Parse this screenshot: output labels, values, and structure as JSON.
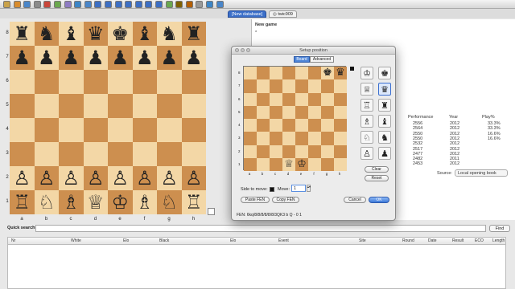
{
  "toolbar": {
    "icons": [
      "new-icon",
      "open-icon",
      "save-icon",
      "print-icon",
      "user-icon",
      "flag-icon",
      "engine-icon",
      "board-icon",
      "refresh-icon",
      "first-icon",
      "back-icon",
      "play-icon",
      "forward-icon",
      "last-icon",
      "next-icon",
      "stop-icon",
      "add-icon",
      "player-icon",
      "book-icon",
      "pin-icon",
      "comment-icon",
      "edit-icon"
    ]
  },
  "tabs": [
    {
      "label": "[New database]",
      "selected": true
    },
    {
      "label": "twic909",
      "selected": false
    }
  ],
  "board": {
    "ranks": [
      "8",
      "7",
      "6",
      "5",
      "4",
      "3",
      "2",
      "1"
    ],
    "files": [
      "a",
      "b",
      "c",
      "d",
      "e",
      "f",
      "g",
      "h"
    ],
    "position": [
      [
        "♜",
        "♞",
        "♝",
        "♛",
        "♚",
        "♝",
        "♞",
        "♜"
      ],
      [
        "♟",
        "♟",
        "♟",
        "♟",
        "♟",
        "♟",
        "♟",
        "♟"
      ],
      [
        "",
        "",
        "",
        "",
        "",
        "",
        "",
        ""
      ],
      [
        "",
        "",
        "",
        "",
        "",
        "",
        "",
        ""
      ],
      [
        "",
        "",
        "",
        "",
        "",
        "",
        "",
        ""
      ],
      [
        "",
        "",
        "",
        "",
        "",
        "",
        "",
        ""
      ],
      [
        "♙",
        "♙",
        "♙",
        "♙",
        "♙",
        "♙",
        "♙",
        "♙"
      ],
      [
        "♖",
        "♘",
        "♗",
        "♕",
        "♔",
        "♗",
        "♘",
        "♖"
      ]
    ]
  },
  "game": {
    "title": "New game",
    "text": "*"
  },
  "stats": {
    "headers": [
      "Performance",
      "Year",
      "Play%"
    ],
    "rows": [
      [
        "2556",
        "2012",
        "33.3%"
      ],
      [
        "2564",
        "2012",
        "33.3%"
      ],
      [
        "2550",
        "2012",
        "16.6%"
      ],
      [
        "2550",
        "2012",
        "16.6%"
      ],
      [
        "2532",
        "2012",
        ""
      ],
      [
        "2517",
        "2012",
        ""
      ],
      [
        "2477",
        "2012",
        ""
      ],
      [
        "2482",
        "2011",
        ""
      ],
      [
        "2453",
        "2012",
        ""
      ]
    ],
    "source_label": "Source:",
    "source_value": "Local opening book"
  },
  "quick_search": {
    "label": "Quick search:",
    "value": "",
    "find_label": "Find"
  },
  "list": {
    "headers": [
      "Nr",
      "White",
      "Elo",
      "Black",
      "Elo",
      "Event",
      "Site",
      "Round",
      "Date",
      "Result",
      "ECO",
      "Length"
    ]
  },
  "dialog": {
    "title": "Setup position",
    "tabs": [
      {
        "label": "Board",
        "selected": true
      },
      {
        "label": "Advanced",
        "selected": false
      }
    ],
    "ranks": [
      "8",
      "7",
      "6",
      "5",
      "4",
      "3",
      "2",
      "1"
    ],
    "files": [
      "a",
      "b",
      "c",
      "d",
      "e",
      "f",
      "g",
      "h"
    ],
    "position": [
      [
        "",
        "",
        "",
        "",
        "",
        "",
        "♚",
        "♛"
      ],
      [
        "",
        "",
        "",
        "",
        "",
        "",
        "",
        ""
      ],
      [
        "",
        "",
        "",
        "",
        "",
        "",
        "",
        ""
      ],
      [
        "",
        "",
        "",
        "",
        "",
        "",
        "",
        ""
      ],
      [
        "",
        "",
        "",
        "",
        "",
        "",
        "",
        ""
      ],
      [
        "",
        "",
        "",
        "",
        "",
        "",
        "",
        ""
      ],
      [
        "",
        "",
        "",
        "",
        "",
        "",
        "",
        ""
      ],
      [
        "",
        "",
        "",
        "♕",
        "♔",
        "",
        "",
        ""
      ]
    ],
    "palette": [
      [
        "♔",
        "♚"
      ],
      [
        "♕",
        "♛"
      ],
      [
        "♖",
        "♜"
      ],
      [
        "♗",
        "♝"
      ],
      [
        "♘",
        "♞"
      ],
      [
        "♙",
        "♟"
      ]
    ],
    "clear_label": "Clear",
    "reset_label": "Reset",
    "side_label": "Side to move:",
    "move_label": "Move:",
    "move_value": "1",
    "paste_label": "Paste FEN",
    "copy_label": "Copy FEN",
    "cancel_label": "Cancel",
    "ok_label": "OK",
    "fen": "FEN: 6kq/8/8/8/8/8/8/3QK3 b Q - 0 1"
  }
}
